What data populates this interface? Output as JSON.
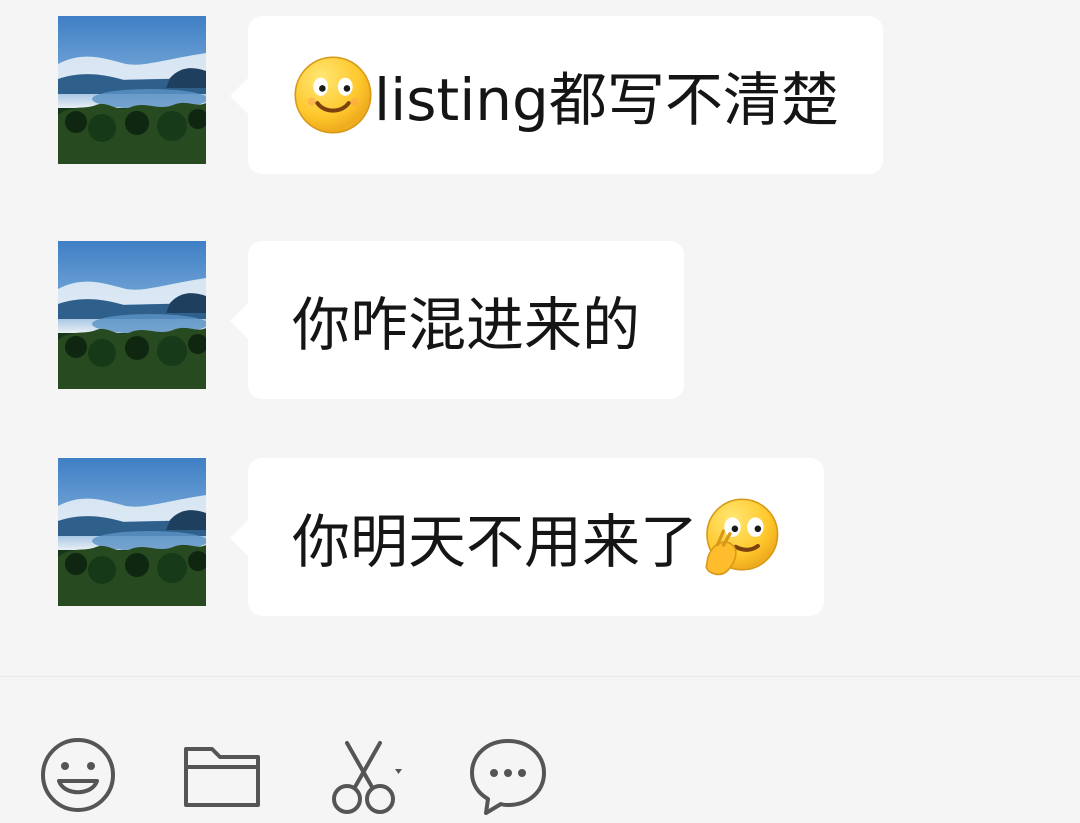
{
  "conversation": {
    "messages": [
      {
        "text": "listing都写不清楚",
        "leading_emoji": "smile-emoji-icon"
      },
      {
        "text": "你咋混进来的"
      },
      {
        "text": "你明天不用来了",
        "trailing_emoji": "thinking-emoji-icon"
      }
    ]
  },
  "toolbar": {
    "icons": [
      "emoji-icon",
      "folder-icon",
      "scissors-icon",
      "chat-icon"
    ]
  },
  "colors": {
    "background": "#f5f5f5",
    "bubble": "#ffffff",
    "text": "#151515",
    "icon": "#555555"
  }
}
